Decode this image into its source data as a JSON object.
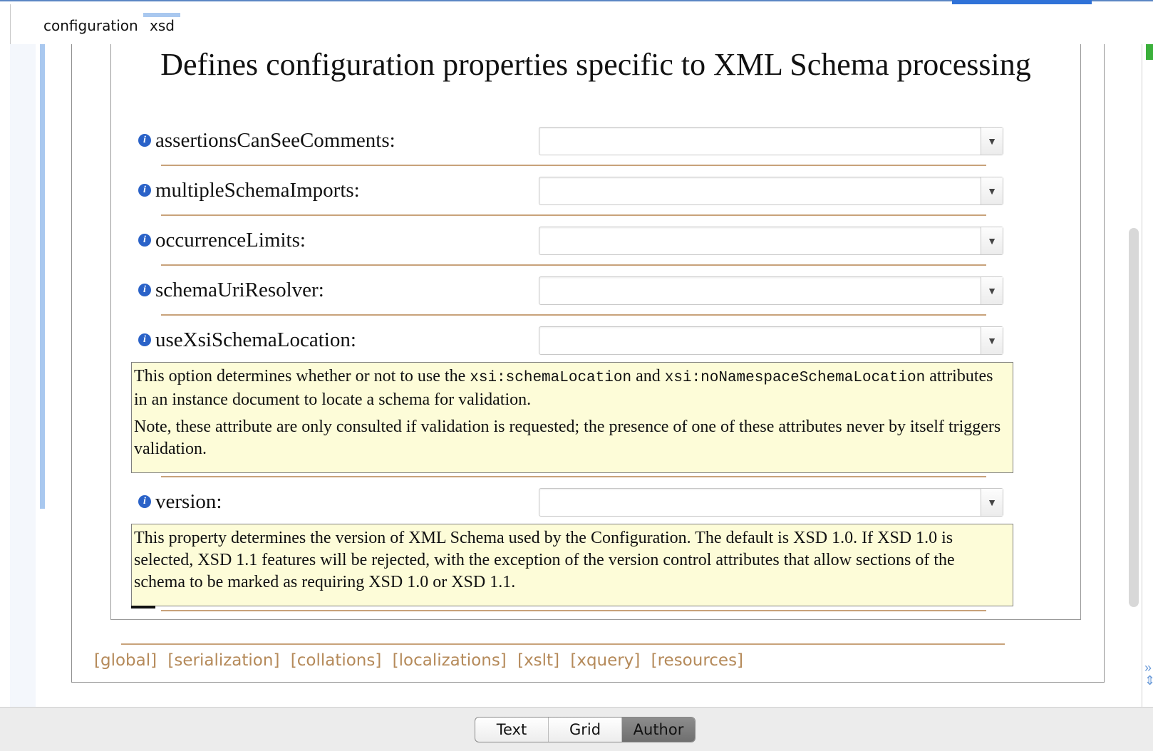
{
  "breadcrumb": {
    "items": [
      "configuration",
      "xsd"
    ]
  },
  "page": {
    "title": "Defines configuration properties specific to XML Schema processing"
  },
  "properties": [
    {
      "label": "assertionsCanSeeComments:",
      "value": ""
    },
    {
      "label": "multipleSchemaImports:",
      "value": ""
    },
    {
      "label": "occurrenceLimits:",
      "value": ""
    },
    {
      "label": "schemaUriResolver:",
      "value": ""
    },
    {
      "label": "useXsiSchemaLocation:",
      "value": ""
    },
    {
      "label": "version:",
      "value": ""
    }
  ],
  "notes": {
    "useXsiSchemaLocation": {
      "p1_a": "This option determines whether or not to use the ",
      "p1_code1": "xsi:schemaLocation",
      "p1_b": " and ",
      "p1_code2": "xsi:noNamespaceSchemaLocation",
      "p1_c": " attributes in an instance document to locate a schema for validation.",
      "p2": "Note, these attribute are only consulted if validation is requested; the presence of one of these attributes never by itself triggers validation."
    },
    "version": {
      "p1": "This property determines the version of XML Schema used by the Configuration. The default is XSD 1.0. If XSD 1.0 is selected, XSD 1.1 features will be rejected, with the exception of the version control attributes that allow sections of the schema to be marked as requiring XSD 1.0 or XSD 1.1."
    }
  },
  "section_links": [
    "[global]",
    "[serialization]",
    "[collations]",
    "[localizations]",
    "[xslt]",
    "[xquery]",
    "[resources]"
  ],
  "mode_switch": {
    "options": [
      "Text",
      "Grid",
      "Author"
    ],
    "selected": "Author"
  },
  "icons": {
    "info": "info-icon",
    "dropdown": "chevron-down-icon"
  },
  "colors": {
    "accent": "#2f72d8",
    "link": "#b58a5a",
    "note_bg": "#fdfcd8",
    "separator": "#c8a27a",
    "status_green": "#3bb03b"
  }
}
